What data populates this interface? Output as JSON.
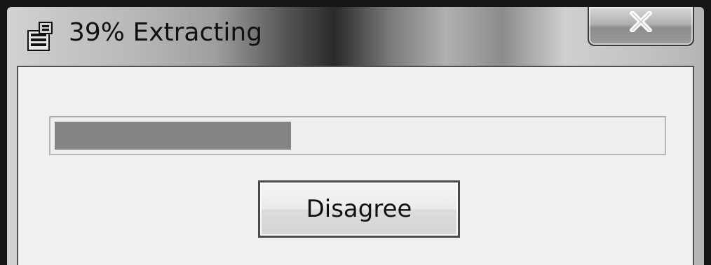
{
  "window": {
    "title": "39% Extracting",
    "app_icon": "installer-package-icon",
    "close_icon": "close-x-icon"
  },
  "progress": {
    "percent": 39
  },
  "buttons": {
    "disagree_label": "Disagree"
  },
  "colors": {
    "progress_fill": "#858585",
    "client_background": "#f0f0f0"
  }
}
